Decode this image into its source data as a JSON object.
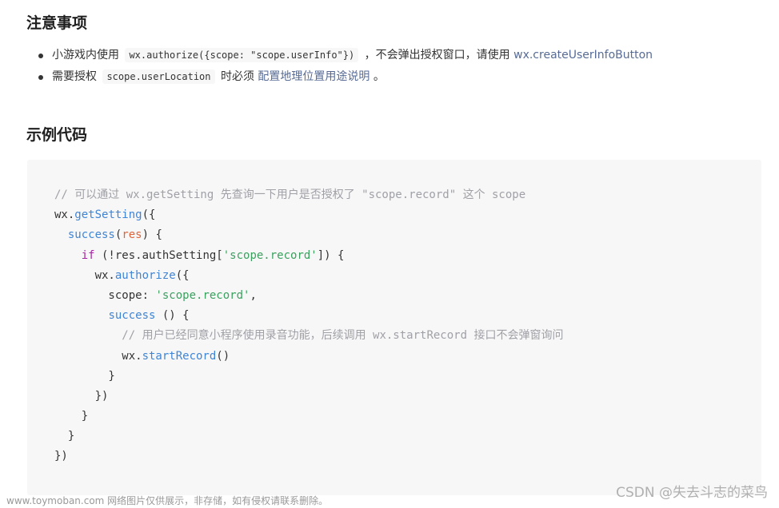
{
  "notes": {
    "title": "注意事项",
    "items": [
      {
        "text_before": "小游戏内使用",
        "code": "wx.authorize({scope: \"scope.userInfo\"})",
        "text_middle": "，不会弹出授权窗口，请使用",
        "link": "wx.createUserInfoButton",
        "text_after": ""
      },
      {
        "text_before": "需要授权",
        "code": "scope.userLocation",
        "text_middle": "时必须",
        "link": "配置地理位置用途说明",
        "text_after": "。"
      }
    ]
  },
  "example": {
    "title": "示例代码",
    "code_lines": [
      [
        {
          "t": "comment",
          "v": "// 可以通过 wx.getSetting 先查询一下用户是否授权了 \"scope.record\" 这个 scope"
        }
      ],
      [
        {
          "t": "plain",
          "v": "wx."
        },
        {
          "t": "fn",
          "v": "getSetting"
        },
        {
          "t": "plain",
          "v": "({"
        }
      ],
      [
        {
          "t": "plain",
          "v": "  "
        },
        {
          "t": "fn",
          "v": "success"
        },
        {
          "t": "plain",
          "v": "("
        },
        {
          "t": "param",
          "v": "res"
        },
        {
          "t": "plain",
          "v": ") {"
        }
      ],
      [
        {
          "t": "plain",
          "v": "    "
        },
        {
          "t": "keyword",
          "v": "if"
        },
        {
          "t": "plain",
          "v": " (!res.authSetting["
        },
        {
          "t": "string",
          "v": "'scope.record'"
        },
        {
          "t": "plain",
          "v": "]) {"
        }
      ],
      [
        {
          "t": "plain",
          "v": "      wx."
        },
        {
          "t": "fn",
          "v": "authorize"
        },
        {
          "t": "plain",
          "v": "({"
        }
      ],
      [
        {
          "t": "plain",
          "v": "        scope: "
        },
        {
          "t": "string",
          "v": "'scope.record'"
        },
        {
          "t": "plain",
          "v": ","
        }
      ],
      [
        {
          "t": "plain",
          "v": "        "
        },
        {
          "t": "fn",
          "v": "success"
        },
        {
          "t": "plain",
          "v": " () {"
        }
      ],
      [
        {
          "t": "plain",
          "v": "          "
        },
        {
          "t": "comment",
          "v": "// 用户已经同意小程序使用录音功能，后续调用 wx.startRecord 接口不会弹窗询问"
        }
      ],
      [
        {
          "t": "plain",
          "v": "          wx."
        },
        {
          "t": "fn",
          "v": "startRecord"
        },
        {
          "t": "plain",
          "v": "()"
        }
      ],
      [
        {
          "t": "plain",
          "v": "        }"
        }
      ],
      [
        {
          "t": "plain",
          "v": "      })"
        }
      ],
      [
        {
          "t": "plain",
          "v": "    }"
        }
      ],
      [
        {
          "t": "plain",
          "v": "  }"
        }
      ],
      [
        {
          "t": "plain",
          "v": "})"
        }
      ]
    ]
  },
  "watermark": {
    "left": "www.toymoban.com 网络图片仅供展示，非存储，如有侵权请联系删除。",
    "right": "CSDN @失去斗志的菜鸟"
  }
}
